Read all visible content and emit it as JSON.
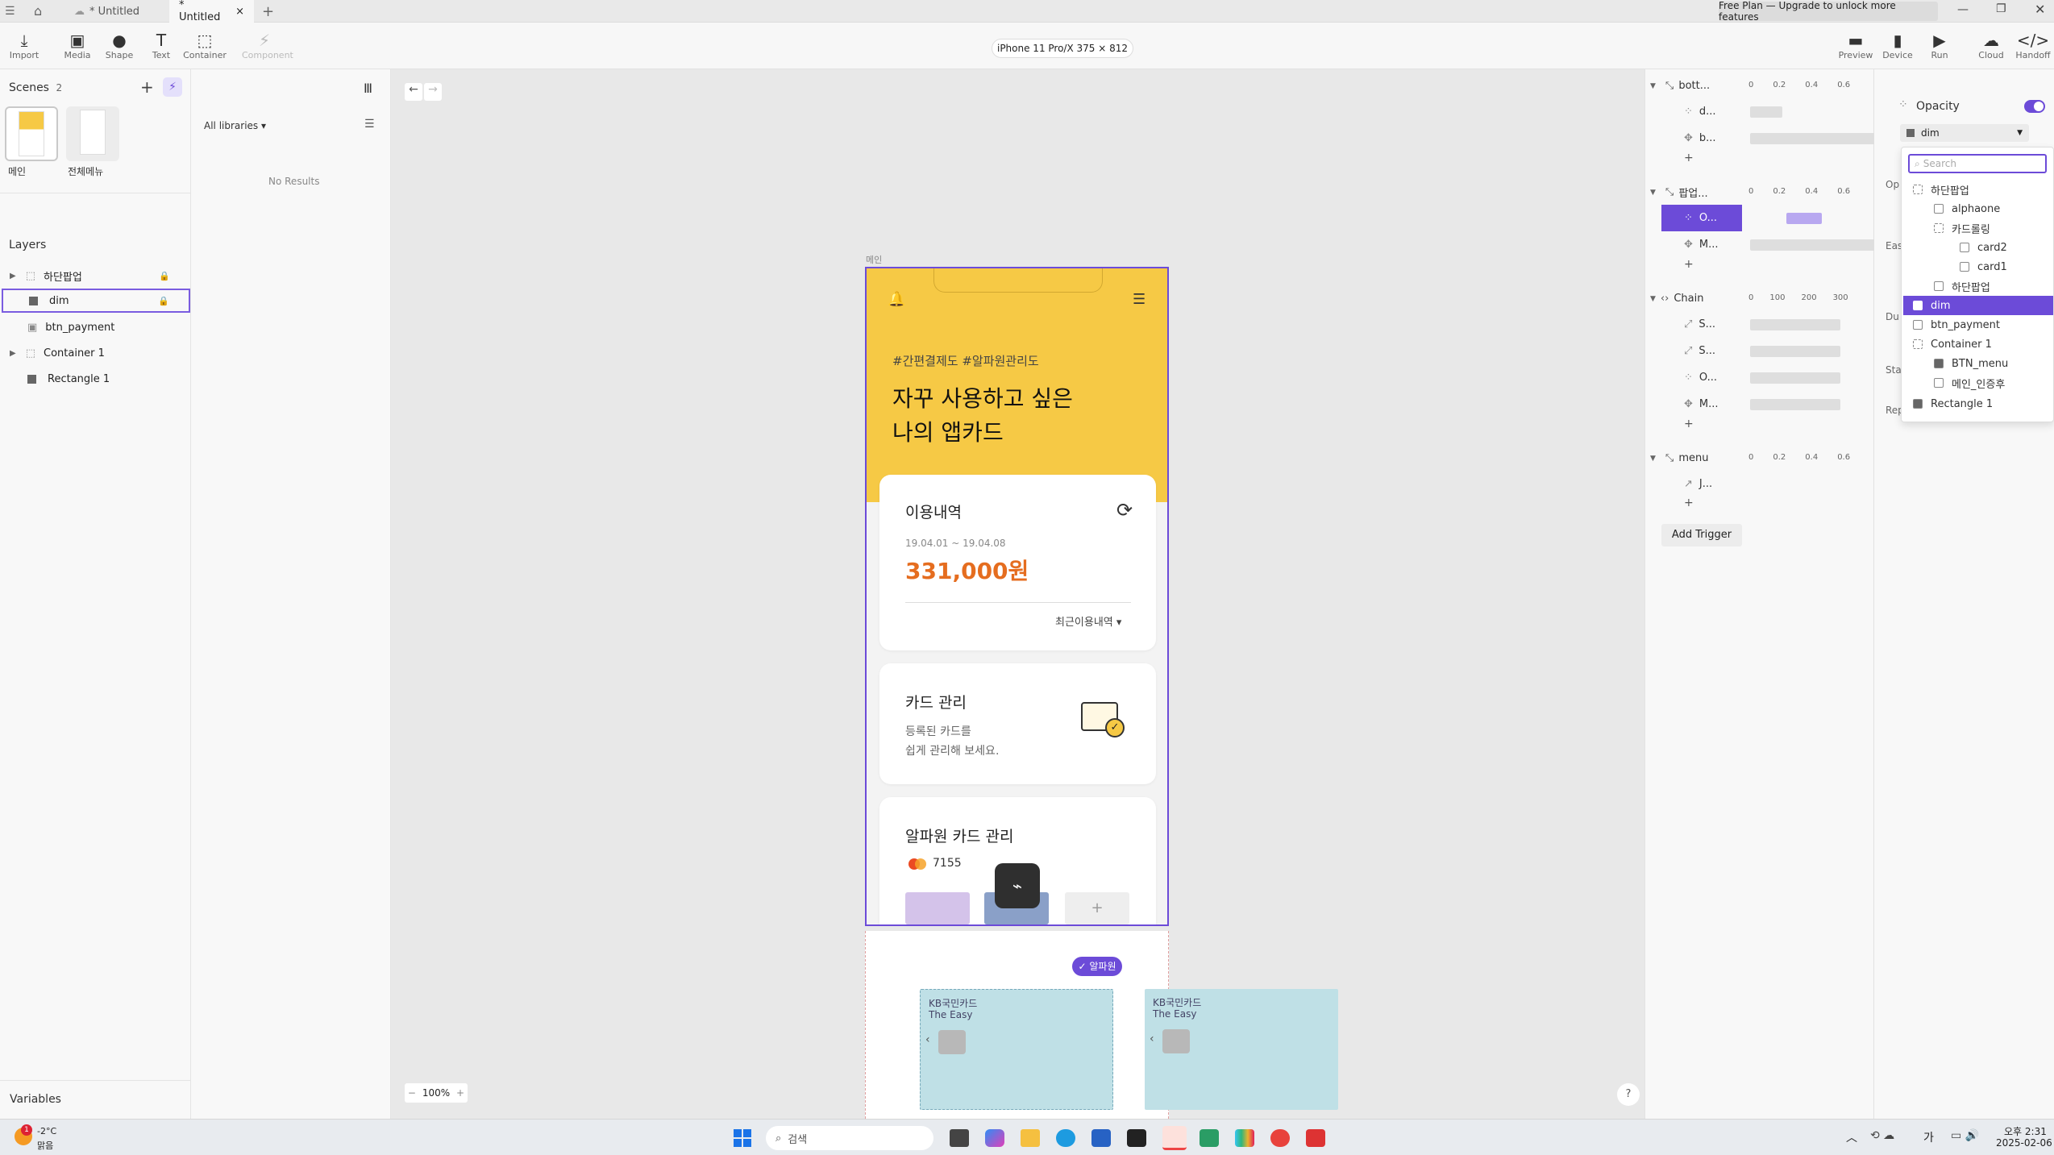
{
  "titlebar": {
    "tabs": [
      "* Untitled",
      "* Untitled"
    ],
    "plan_banner": "Free Plan — Upgrade to unlock more features"
  },
  "toolbar": {
    "import": "Import",
    "media": "Media",
    "shape": "Shape",
    "text": "Text",
    "container": "Container",
    "component": "Component",
    "device_label": "iPhone 11 Pro/X  375 × 812",
    "preview": "Preview",
    "device": "Device",
    "run": "Run",
    "cloud": "Cloud",
    "handoff": "Handoff"
  },
  "scenes": {
    "title": "Scenes",
    "count": "2",
    "items": [
      "메인",
      "전체메뉴"
    ]
  },
  "libraries": {
    "filter": "All libraries",
    "empty": "No Results"
  },
  "layers": {
    "title": "Layers",
    "items": [
      "하단팝업",
      "dim",
      "btn_payment",
      "Container 1",
      "Rectangle 1"
    ]
  },
  "variables": {
    "title": "Variables"
  },
  "canvas": {
    "scene_label": "메인",
    "zoom": "100%"
  },
  "phone": {
    "hashtags": "#간편결제도 #알파원관리도",
    "headline1": "자꾸 사용하고 싶은",
    "headline2": "나의 앱카드",
    "usage_title": "이용내역",
    "usage_period": "19.04.01 ~ 19.04.08",
    "usage_amount": "331,000원",
    "usage_recent": "최근이용내역",
    "card_mgmt_title": "카드 관리",
    "card_mgmt_desc1": "등록된 카드를",
    "card_mgmt_desc2": "쉽게 관리해 보세요.",
    "alphaone_title": "알파원 카드 관리",
    "alphaone_num": "7155"
  },
  "popup": {
    "badge": "알파원",
    "card_brand": "KB국민카드",
    "card_name": "The Easy"
  },
  "timeline": {
    "groups": [
      {
        "name": "bott...",
        "rows": [
          "d...",
          "b..."
        ],
        "ticks": [
          "0",
          "0.2",
          "0.4",
          "0.6"
        ]
      },
      {
        "name": "팝업...",
        "rows": [
          "O...",
          "M..."
        ],
        "ticks": [
          "0",
          "0.2",
          "0.4",
          "0.6"
        ]
      },
      {
        "name": "Chain",
        "rows": [
          "S...",
          "S...",
          "O...",
          "M..."
        ],
        "ticks": [
          "0",
          "100",
          "200",
          "300"
        ]
      },
      {
        "name": "menu",
        "rows": [
          "J..."
        ],
        "ticks": [
          "0",
          "0.2",
          "0.4",
          "0.6"
        ]
      }
    ],
    "add_trigger": "Add Trigger"
  },
  "inspector": {
    "opacity_label": "Opacity",
    "target_value": "dim",
    "partial_labels": [
      "Op",
      "Eas",
      "Du",
      "Sta",
      "Rep"
    ],
    "toggle_on": true
  },
  "dropdown": {
    "search_placeholder": "Search",
    "items": [
      "하단팝업",
      "alphaone",
      "카드롤링",
      "card2",
      "card1",
      "하단팝업",
      "dim",
      "btn_payment",
      "Container 1",
      "BTN_menu",
      "메인_인증후",
      "Rectangle 1"
    ],
    "selected": "dim"
  },
  "taskbar": {
    "weather_temp": "-2°C",
    "weather_desc": "맑음",
    "search": "검색",
    "time": "오후 2:31",
    "date": "2025-02-06",
    "badge": "1",
    "ime": "가"
  },
  "colors": {
    "accent": "#6c4bd8",
    "yellow": "#f6c945",
    "orange": "#e56d1f"
  }
}
